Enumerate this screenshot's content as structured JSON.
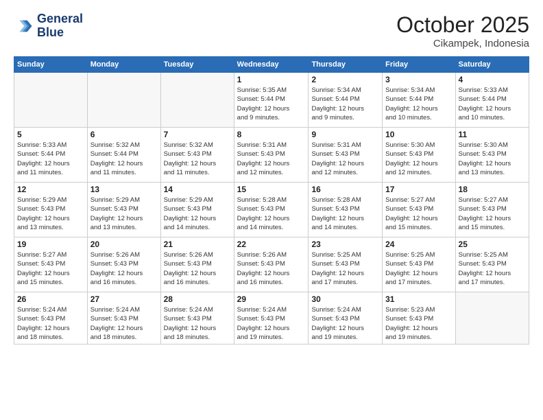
{
  "logo": {
    "line1": "General",
    "line2": "Blue"
  },
  "title": "October 2025",
  "location": "Cikampek, Indonesia",
  "days_of_week": [
    "Sunday",
    "Monday",
    "Tuesday",
    "Wednesday",
    "Thursday",
    "Friday",
    "Saturday"
  ],
  "weeks": [
    [
      {
        "day": "",
        "info": ""
      },
      {
        "day": "",
        "info": ""
      },
      {
        "day": "",
        "info": ""
      },
      {
        "day": "1",
        "info": "Sunrise: 5:35 AM\nSunset: 5:44 PM\nDaylight: 12 hours\nand 9 minutes."
      },
      {
        "day": "2",
        "info": "Sunrise: 5:34 AM\nSunset: 5:44 PM\nDaylight: 12 hours\nand 9 minutes."
      },
      {
        "day": "3",
        "info": "Sunrise: 5:34 AM\nSunset: 5:44 PM\nDaylight: 12 hours\nand 10 minutes."
      },
      {
        "day": "4",
        "info": "Sunrise: 5:33 AM\nSunset: 5:44 PM\nDaylight: 12 hours\nand 10 minutes."
      }
    ],
    [
      {
        "day": "5",
        "info": "Sunrise: 5:33 AM\nSunset: 5:44 PM\nDaylight: 12 hours\nand 11 minutes."
      },
      {
        "day": "6",
        "info": "Sunrise: 5:32 AM\nSunset: 5:44 PM\nDaylight: 12 hours\nand 11 minutes."
      },
      {
        "day": "7",
        "info": "Sunrise: 5:32 AM\nSunset: 5:43 PM\nDaylight: 12 hours\nand 11 minutes."
      },
      {
        "day": "8",
        "info": "Sunrise: 5:31 AM\nSunset: 5:43 PM\nDaylight: 12 hours\nand 12 minutes."
      },
      {
        "day": "9",
        "info": "Sunrise: 5:31 AM\nSunset: 5:43 PM\nDaylight: 12 hours\nand 12 minutes."
      },
      {
        "day": "10",
        "info": "Sunrise: 5:30 AM\nSunset: 5:43 PM\nDaylight: 12 hours\nand 12 minutes."
      },
      {
        "day": "11",
        "info": "Sunrise: 5:30 AM\nSunset: 5:43 PM\nDaylight: 12 hours\nand 13 minutes."
      }
    ],
    [
      {
        "day": "12",
        "info": "Sunrise: 5:29 AM\nSunset: 5:43 PM\nDaylight: 12 hours\nand 13 minutes."
      },
      {
        "day": "13",
        "info": "Sunrise: 5:29 AM\nSunset: 5:43 PM\nDaylight: 12 hours\nand 13 minutes."
      },
      {
        "day": "14",
        "info": "Sunrise: 5:29 AM\nSunset: 5:43 PM\nDaylight: 12 hours\nand 14 minutes."
      },
      {
        "day": "15",
        "info": "Sunrise: 5:28 AM\nSunset: 5:43 PM\nDaylight: 12 hours\nand 14 minutes."
      },
      {
        "day": "16",
        "info": "Sunrise: 5:28 AM\nSunset: 5:43 PM\nDaylight: 12 hours\nand 14 minutes."
      },
      {
        "day": "17",
        "info": "Sunrise: 5:27 AM\nSunset: 5:43 PM\nDaylight: 12 hours\nand 15 minutes."
      },
      {
        "day": "18",
        "info": "Sunrise: 5:27 AM\nSunset: 5:43 PM\nDaylight: 12 hours\nand 15 minutes."
      }
    ],
    [
      {
        "day": "19",
        "info": "Sunrise: 5:27 AM\nSunset: 5:43 PM\nDaylight: 12 hours\nand 15 minutes."
      },
      {
        "day": "20",
        "info": "Sunrise: 5:26 AM\nSunset: 5:43 PM\nDaylight: 12 hours\nand 16 minutes."
      },
      {
        "day": "21",
        "info": "Sunrise: 5:26 AM\nSunset: 5:43 PM\nDaylight: 12 hours\nand 16 minutes."
      },
      {
        "day": "22",
        "info": "Sunrise: 5:26 AM\nSunset: 5:43 PM\nDaylight: 12 hours\nand 16 minutes."
      },
      {
        "day": "23",
        "info": "Sunrise: 5:25 AM\nSunset: 5:43 PM\nDaylight: 12 hours\nand 17 minutes."
      },
      {
        "day": "24",
        "info": "Sunrise: 5:25 AM\nSunset: 5:43 PM\nDaylight: 12 hours\nand 17 minutes."
      },
      {
        "day": "25",
        "info": "Sunrise: 5:25 AM\nSunset: 5:43 PM\nDaylight: 12 hours\nand 17 minutes."
      }
    ],
    [
      {
        "day": "26",
        "info": "Sunrise: 5:24 AM\nSunset: 5:43 PM\nDaylight: 12 hours\nand 18 minutes."
      },
      {
        "day": "27",
        "info": "Sunrise: 5:24 AM\nSunset: 5:43 PM\nDaylight: 12 hours\nand 18 minutes."
      },
      {
        "day": "28",
        "info": "Sunrise: 5:24 AM\nSunset: 5:43 PM\nDaylight: 12 hours\nand 18 minutes."
      },
      {
        "day": "29",
        "info": "Sunrise: 5:24 AM\nSunset: 5:43 PM\nDaylight: 12 hours\nand 19 minutes."
      },
      {
        "day": "30",
        "info": "Sunrise: 5:24 AM\nSunset: 5:43 PM\nDaylight: 12 hours\nand 19 minutes."
      },
      {
        "day": "31",
        "info": "Sunrise: 5:23 AM\nSunset: 5:43 PM\nDaylight: 12 hours\nand 19 minutes."
      },
      {
        "day": "",
        "info": ""
      }
    ]
  ]
}
